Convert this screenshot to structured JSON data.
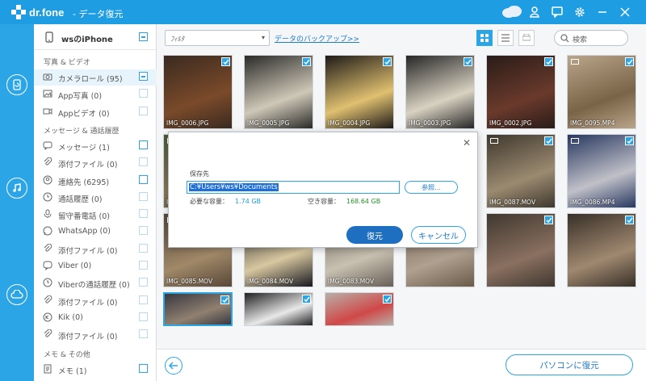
{
  "app": {
    "logo": "dr.fone",
    "title": "- データ復元"
  },
  "device": {
    "name": "wsのiPhone"
  },
  "sections": [
    {
      "header": "写真 & ビデオ",
      "items": [
        {
          "label": "カメラロール (95)",
          "icon": "camera-icon",
          "state": "partial",
          "selected": true
        },
        {
          "label": "App写真 (0)",
          "icon": "image-icon",
          "state": "disabled"
        },
        {
          "label": "Appビデオ (0)",
          "icon": "video-icon",
          "state": "disabled"
        }
      ]
    },
    {
      "header": "メッセージ & 通話履歴",
      "items": [
        {
          "label": "メッセージ (1)",
          "icon": "message-icon",
          "state": "empty"
        },
        {
          "label": "添付ファイル (0)",
          "icon": "paperclip-icon",
          "state": "disabled"
        },
        {
          "label": "連絡先 (6295)",
          "icon": "contact-icon",
          "state": "empty"
        },
        {
          "label": "通話履歴 (0)",
          "icon": "clock-icon",
          "state": "disabled"
        },
        {
          "label": "留守番電話 (0)",
          "icon": "voicemail-icon",
          "state": "disabled"
        },
        {
          "label": "WhatsApp (0)",
          "icon": "whatsapp-icon",
          "state": "disabled"
        },
        {
          "label": "添付ファイル (0)",
          "icon": "paperclip-icon",
          "state": "disabled"
        },
        {
          "label": "Viber (0)",
          "icon": "viber-icon",
          "state": "disabled"
        },
        {
          "label": "Viberの通話履歴 (0)",
          "icon": "clock-icon",
          "state": "disabled"
        },
        {
          "label": "添付ファイル (0)",
          "icon": "paperclip-icon",
          "state": "disabled"
        },
        {
          "label": "Kik (0)",
          "icon": "kik-icon",
          "state": "disabled"
        },
        {
          "label": "添付ファイル (0)",
          "icon": "paperclip-icon",
          "state": "disabled"
        }
      ]
    },
    {
      "header": "メモ & その他",
      "items": [
        {
          "label": "メモ (1)",
          "icon": "note-icon",
          "state": "empty"
        }
      ]
    }
  ],
  "toolbar": {
    "filter": "ﾌｨﾙﾀ",
    "backup_link": "データのバックアップ>>",
    "search_placeholder": "検索"
  },
  "photos": [
    {
      "name": "IMG_0006.JPG",
      "video": false,
      "colors": [
        "#3a2a20",
        "#7a4a2a"
      ]
    },
    {
      "name": "IMG_0005.JPG",
      "video": false,
      "colors": [
        "#2a2a28",
        "#cfc8b8"
      ]
    },
    {
      "name": "IMG_0004.JPG",
      "video": false,
      "colors": [
        "#1e1a18",
        "#e0c070"
      ]
    },
    {
      "name": "IMG_0003.JPG",
      "video": false,
      "colors": [
        "#262626",
        "#d9d2c2"
      ]
    },
    {
      "name": "IMG_0002.JPG",
      "video": false,
      "colors": [
        "#2a1c18",
        "#6a3a2c"
      ]
    },
    {
      "name": "IMG_0095.MP4",
      "video": true,
      "colors": [
        "#bba58a",
        "#7a6448"
      ]
    },
    {
      "name": "IMG_0091.MP4",
      "video": true,
      "colors": [
        "#4a5a38",
        "#8a7858"
      ]
    },
    {
      "name": "IMG_0090.MP4",
      "video": true,
      "colors": [
        "#708868",
        "#a89070"
      ]
    },
    {
      "name": "IMG_0089.MOV",
      "video": true,
      "colors": [
        "#302050",
        "#c86ac0"
      ]
    },
    {
      "name": "IMG_0088.MOV",
      "video": true,
      "colors": [
        "#3a3a40",
        "#8a8070"
      ]
    },
    {
      "name": "IMG_0087.MOV",
      "video": true,
      "colors": [
        "#40382e",
        "#9a8a70"
      ]
    },
    {
      "name": "IMG_0086.MP4",
      "video": true,
      "colors": [
        "#283860",
        "#c0c0c8"
      ]
    },
    {
      "name": "IMG_0085.MOV",
      "video": true,
      "colors": [
        "#584838",
        "#a08868"
      ]
    },
    {
      "name": "IMG_0084.MOV",
      "video": true,
      "colors": [
        "#181820",
        "#d8c8a0"
      ]
    },
    {
      "name": "IMG_0083.MOV",
      "video": true,
      "colors": [
        "#686058",
        "#c8c0b0"
      ]
    },
    {
      "name": "",
      "video": false,
      "colors": [
        "#6a5a48",
        "#b0a090"
      ]
    },
    {
      "name": "",
      "video": false,
      "colors": [
        "#403830",
        "#8a7060"
      ]
    },
    {
      "name": "",
      "video": false,
      "colors": [
        "#383028",
        "#a08870"
      ]
    },
    {
      "name": "",
      "video": false,
      "colors": [
        "#383840",
        "#908070"
      ]
    },
    {
      "name": "",
      "video": false,
      "colors": [
        "#202020",
        "#e8e8e8"
      ]
    },
    {
      "name": "",
      "video": false,
      "colors": [
        "#b8b0a8",
        "#d04848"
      ]
    }
  ],
  "bottom": {
    "restore_label": "パソコンに復元"
  },
  "dialog": {
    "label": "保存先",
    "path": "C:¥Users¥ws¥Documents",
    "browse": "参照...",
    "required_label": "必要な容量：",
    "required_value": "1.74 GB",
    "free_label": "空き容量：",
    "free_value": "168.64 GB",
    "ok": "復元",
    "cancel": "キャンセル"
  },
  "colors": {
    "accent": "#2ba5e6",
    "primary_button": "#1e6fc0"
  }
}
